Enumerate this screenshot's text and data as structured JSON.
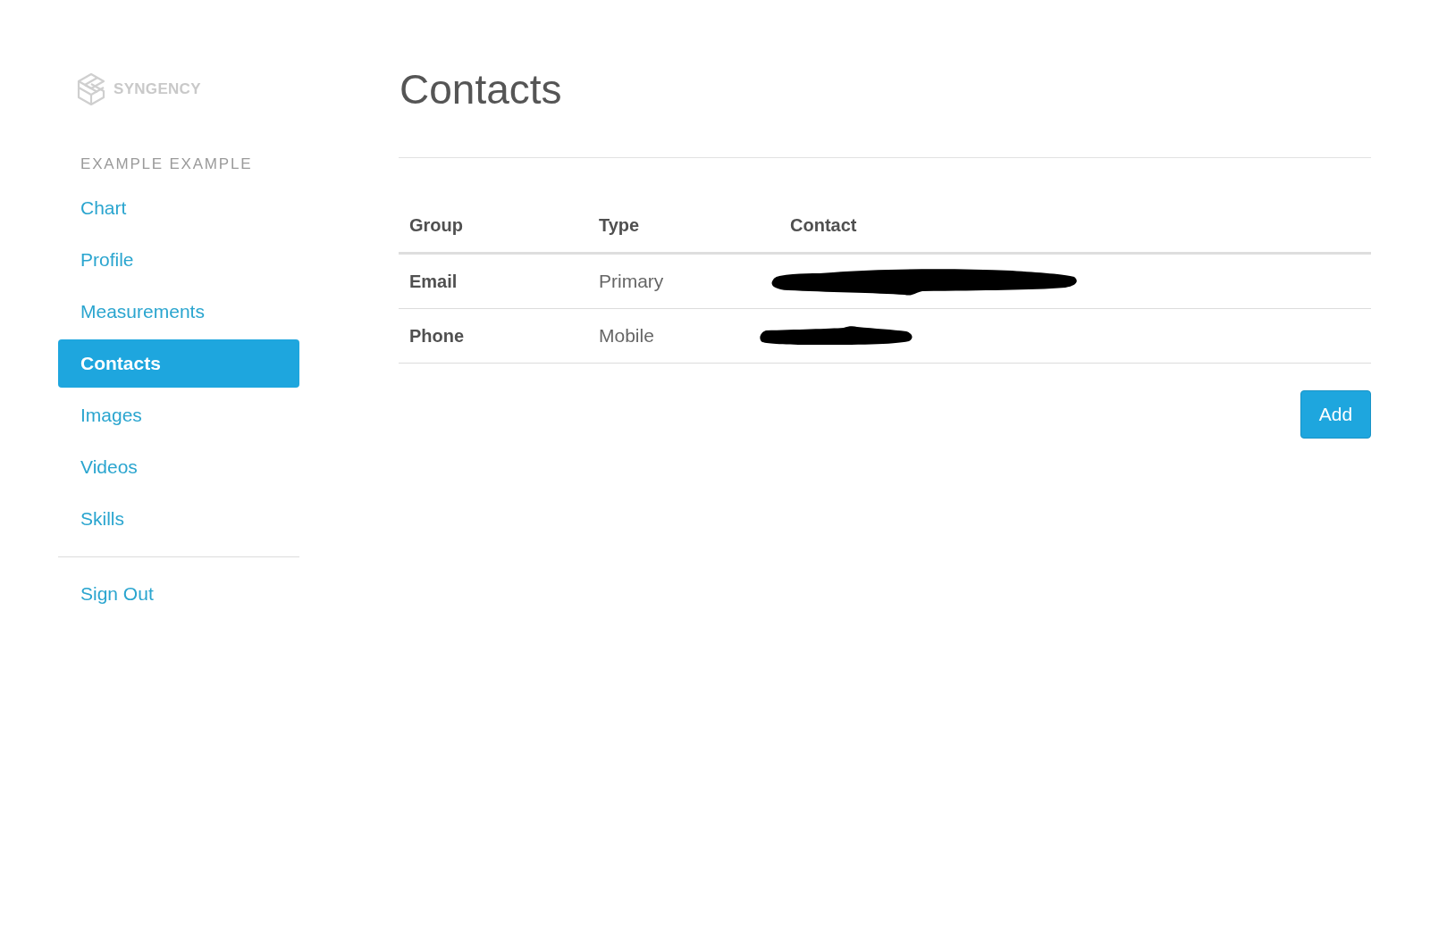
{
  "brand": {
    "name": "SYNGENCY"
  },
  "sidebar": {
    "user": "EXAMPLE EXAMPLE",
    "items": [
      {
        "label": "Chart",
        "selected": false
      },
      {
        "label": "Profile",
        "selected": false
      },
      {
        "label": "Measurements",
        "selected": false
      },
      {
        "label": "Contacts",
        "selected": true
      },
      {
        "label": "Images",
        "selected": false
      },
      {
        "label": "Videos",
        "selected": false
      },
      {
        "label": "Skills",
        "selected": false
      }
    ],
    "footer_items": [
      {
        "label": "Sign Out"
      }
    ]
  },
  "page": {
    "title": "Contacts"
  },
  "table": {
    "columns": [
      "Group",
      "Type",
      "Contact"
    ],
    "rows": [
      {
        "group": "Email",
        "type": "Primary",
        "contact_redacted": true
      },
      {
        "group": "Phone",
        "type": "Mobile",
        "contact_redacted": true
      }
    ]
  },
  "add_button": {
    "label": "Add"
  }
}
